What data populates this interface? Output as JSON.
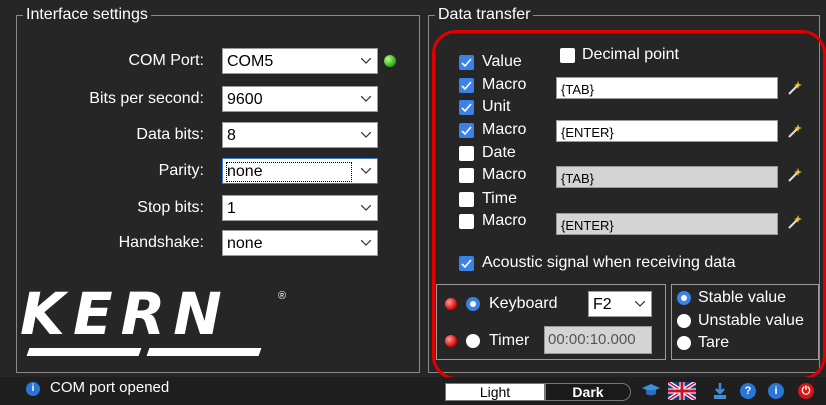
{
  "interface": {
    "title": "Interface settings",
    "com_port": {
      "label": "COM Port:",
      "value": "COM5"
    },
    "bits_per_second": {
      "label": "Bits per second:",
      "value": "9600"
    },
    "data_bits": {
      "label": "Data bits:",
      "value": "8"
    },
    "parity": {
      "label": "Parity:",
      "value": "none"
    },
    "stop_bits": {
      "label": "Stop bits:",
      "value": "1"
    },
    "handshake": {
      "label": "Handshake:",
      "value": "none"
    }
  },
  "logo": {
    "text": "KERN",
    "registered": "®"
  },
  "transfer": {
    "title": "Data transfer",
    "decimal_point": {
      "label": "Decimal point",
      "checked": false
    },
    "value": {
      "label": "Value",
      "checked": true
    },
    "macro1": {
      "label": "Macro",
      "checked": true,
      "text": "{TAB}",
      "enabled": true
    },
    "unit": {
      "label": "Unit",
      "checked": true
    },
    "macro2": {
      "label": "Macro",
      "checked": true,
      "text": "{ENTER}",
      "enabled": true
    },
    "date": {
      "label": "Date",
      "checked": false
    },
    "macro3": {
      "label": "Macro",
      "checked": false,
      "text": "{TAB}",
      "enabled": false
    },
    "time": {
      "label": "Time",
      "checked": false
    },
    "macro4": {
      "label": "Macro",
      "checked": false,
      "text": "{ENTER}",
      "enabled": false
    },
    "acoustic": {
      "label": "Acoustic signal when receiving data",
      "checked": true
    }
  },
  "mode": {
    "keyboard": {
      "label": "Keyboard",
      "selected": true,
      "key": "F2"
    },
    "timer": {
      "label": "Timer",
      "selected": false,
      "interval": "00:00:10.000"
    }
  },
  "value_type": {
    "stable": {
      "label": "Stable value",
      "selected": true
    },
    "unstable": {
      "label": "Unstable value",
      "selected": false
    },
    "tare": {
      "label": "Tare",
      "selected": false
    }
  },
  "status": {
    "message": "COM port opened",
    "theme_light": "Light",
    "theme_dark": "Dark",
    "help_glyph": "?",
    "info_glyph": "i",
    "power_glyph": "⏻"
  },
  "colors": {
    "accent": "#3b82e8",
    "highlight": "#e00000",
    "led_on": "#2fa30f"
  }
}
